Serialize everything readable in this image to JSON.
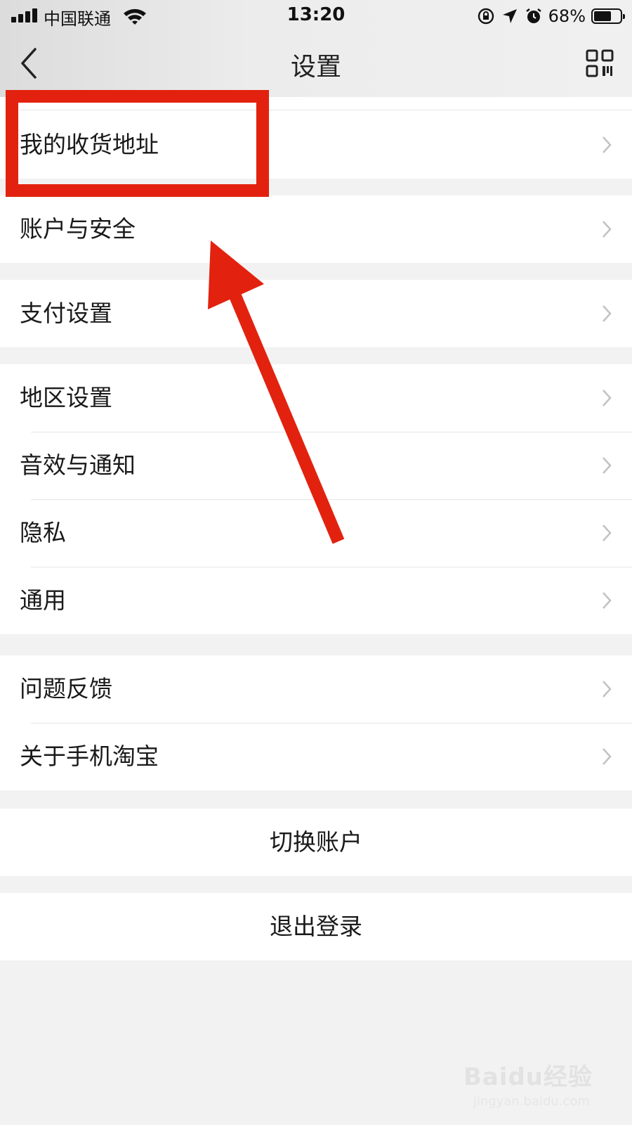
{
  "status_bar": {
    "carrier": "中国联通",
    "time": "13:20",
    "battery": "68%",
    "battery_level": 0.68,
    "icons": [
      "signal-icon",
      "wifi-icon",
      "orientation-lock-icon",
      "location-icon",
      "alarm-icon",
      "battery-icon"
    ]
  },
  "nav": {
    "title": "设置",
    "back_icon": "chevron-left-icon",
    "qr_icon": "qr-code-icon"
  },
  "groups": [
    {
      "items": [
        {
          "label": "我的收货地址"
        }
      ]
    },
    {
      "items": [
        {
          "label": "账户与安全"
        }
      ]
    },
    {
      "items": [
        {
          "label": "支付设置"
        }
      ]
    },
    {
      "items": [
        {
          "label": "地区设置"
        },
        {
          "label": "音效与通知"
        },
        {
          "label": "隐私"
        },
        {
          "label": "通用"
        }
      ]
    },
    {
      "items": [
        {
          "label": "问题反馈"
        },
        {
          "label": "关于手机淘宝"
        }
      ]
    }
  ],
  "actions": {
    "switch_account": "切换账户",
    "logout": "退出登录"
  },
  "annotation": {
    "highlight_color": "#e2220e",
    "arrow_color": "#e2220e"
  },
  "watermark": {
    "brand": "Baidu经验",
    "url": "jingyan.baidu.com"
  }
}
